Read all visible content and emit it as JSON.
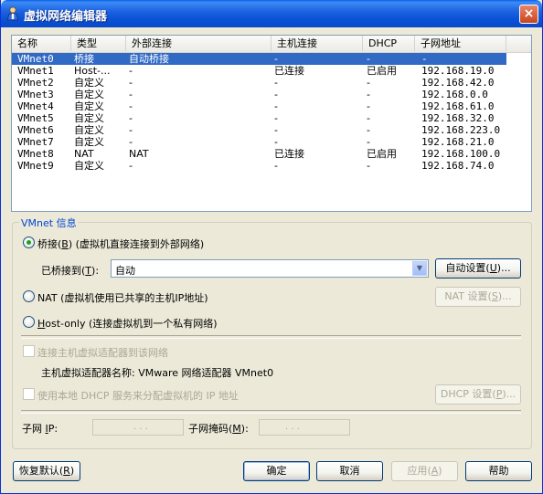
{
  "window": {
    "title": "虚拟网络编辑器",
    "close": "×"
  },
  "table": {
    "headers": [
      "名称",
      "类型",
      "外部连接",
      "主机连接",
      "DHCP",
      "子网地址"
    ],
    "rows": [
      [
        "VMnet0",
        "桥接",
        "自动桥接",
        "-",
        "-",
        "-"
      ],
      [
        "VMnet1",
        "Host-...",
        "-",
        "已连接",
        "已启用",
        "192.168.19.0"
      ],
      [
        "VMnet2",
        "自定义",
        "-",
        "-",
        "-",
        "192.168.42.0"
      ],
      [
        "VMnet3",
        "自定义",
        "-",
        "-",
        "-",
        "192.168.0.0"
      ],
      [
        "VMnet4",
        "自定义",
        "-",
        "-",
        "-",
        "192.168.61.0"
      ],
      [
        "VMnet5",
        "自定义",
        "-",
        "-",
        "-",
        "192.168.32.0"
      ],
      [
        "VMnet6",
        "自定义",
        "-",
        "-",
        "-",
        "192.168.223.0"
      ],
      [
        "VMnet7",
        "自定义",
        "-",
        "-",
        "-",
        "192.168.21.0"
      ],
      [
        "VMnet8",
        "NAT",
        "NAT",
        "已连接",
        "已启用",
        "192.168.100.0"
      ],
      [
        "VMnet9",
        "自定义",
        "-",
        "-",
        "-",
        "192.168.74.0"
      ]
    ],
    "selected_row": 0
  },
  "info": {
    "group_title": "VMnet 信息",
    "bridged": {
      "prefix": "桥接",
      "key": "B",
      "rest": "(虚拟机直接连接到外部网络)",
      "selected": true
    },
    "bridged_to": {
      "label_prefix": "已桥接到",
      "key": "T",
      "label_suffix": "):",
      "value": "自动"
    },
    "auto_settings": {
      "prefix": "自动设置",
      "key": "U",
      "suffix": ")..."
    },
    "nat": {
      "label": "NAT (虚拟机使用已共享的主机IP地址)"
    },
    "nat_settings": {
      "prefix": "NAT 设置",
      "key": "S",
      "suffix": ")..."
    },
    "hostonly": {
      "key": "H",
      "rest": "ost-only (连接虚拟机到一个私有网络)"
    },
    "connect_adapter": {
      "label": "连接主机虚拟适配器到该网络"
    },
    "adapter_name": {
      "label": "主机虚拟适配器名称: VMware 网络适配器 VMnet0"
    },
    "use_dhcp": {
      "label": "使用本地 DHCP 服务来分配虚拟机的 IP 地址"
    },
    "dhcp_settings": {
      "prefix": "DHCP 设置",
      "key": "P",
      "suffix": "..."
    },
    "subnet_ip": {
      "prefix": "子网 ",
      "key": "I",
      "suffix": "P:"
    },
    "subnet_mask": {
      "prefix": "子网掩码",
      "key": "M",
      "suffix": "):"
    },
    "ip_dots": ". . ."
  },
  "buttons": {
    "restore": {
      "prefix": "恢复默认",
      "key": "R",
      "suffix": ")"
    },
    "ok": "确定",
    "cancel": "取消",
    "apply": {
      "prefix": "应用",
      "key": "A",
      "suffix": ")"
    },
    "help": "帮助"
  }
}
